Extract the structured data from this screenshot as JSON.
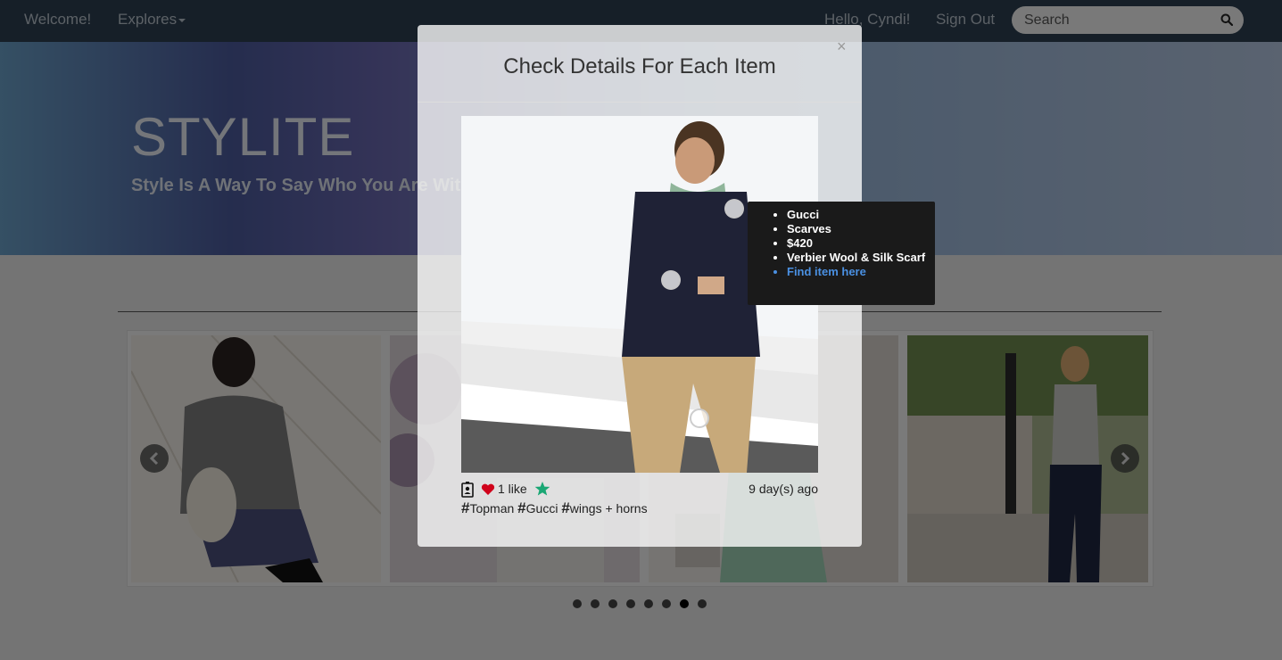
{
  "navbar": {
    "welcome": "Welcome!",
    "explores": "Explores",
    "greeting": "Hello, Cyndi!",
    "signout": "Sign Out",
    "search_placeholder": "Search"
  },
  "hero": {
    "title": "STYLITE",
    "subtitle": "Style Is A Way To Say Who You Are With"
  },
  "carousel": {
    "dots_count": 8,
    "active_dot": 6
  },
  "modal": {
    "close": "×",
    "title": "Check Details For Each Item",
    "likes": "1 like",
    "time_ago": "9 day(s) ago",
    "tags": [
      "Topman",
      "Gucci",
      "wings + horns"
    ],
    "hash": "#"
  },
  "tooltip": {
    "brand": "Gucci",
    "category": "Scarves",
    "price": "$420",
    "name": "Verbier Wool & Silk Scarf",
    "link": "Find item here"
  },
  "colors": {
    "navbar": "#2c3e50",
    "heart": "#d0021b",
    "star": "#1aa774",
    "link": "#4a90e2"
  }
}
